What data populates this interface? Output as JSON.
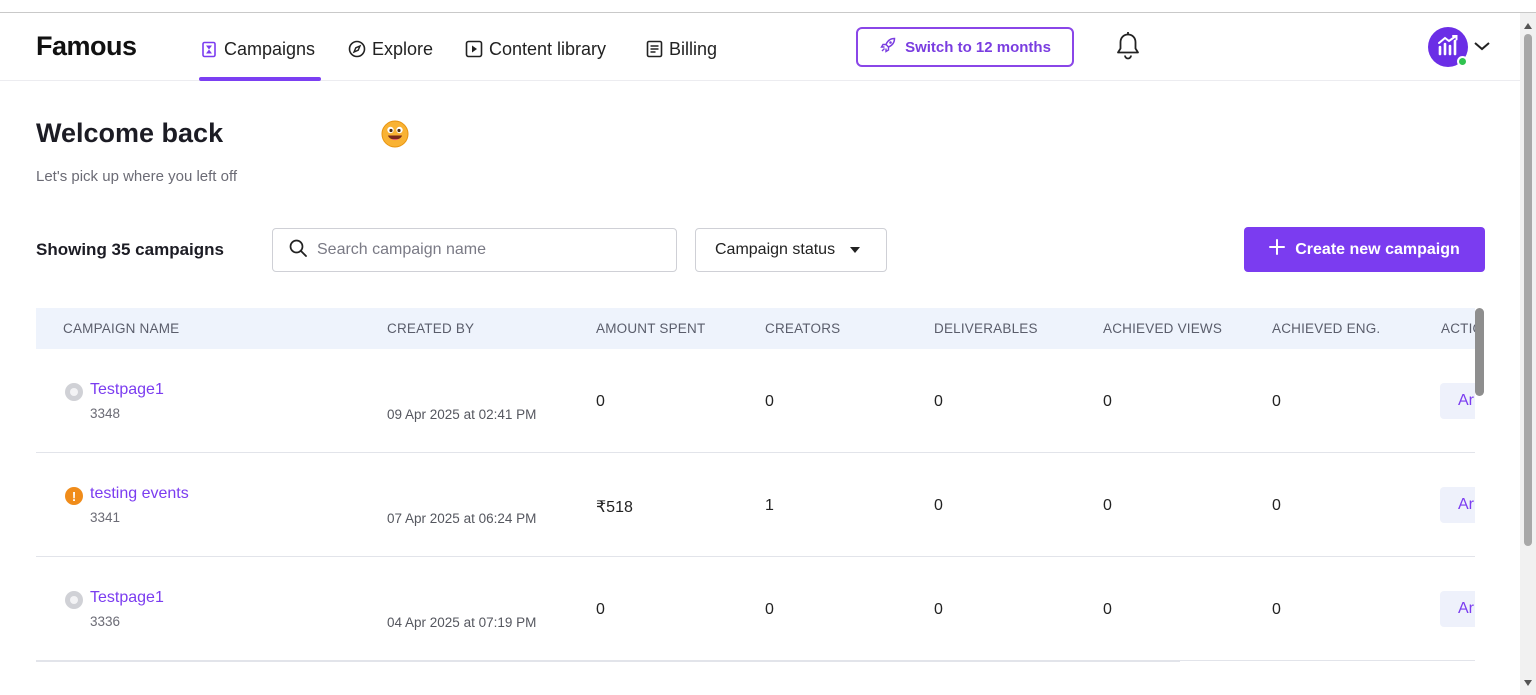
{
  "app": {
    "logo": "Famous"
  },
  "nav": {
    "items": [
      {
        "label": "Campaigns",
        "icon": "hourglass-icon",
        "active": true
      },
      {
        "label": "Explore",
        "icon": "compass-icon"
      },
      {
        "label": "Content library",
        "icon": "play-square-icon"
      },
      {
        "label": "Billing",
        "icon": "document-icon"
      }
    ]
  },
  "header": {
    "switch_label": "Switch to 12 months",
    "switch_icon": "rocket-icon",
    "bell_icon": "bell-icon",
    "avatar_icon": "chart-growth-icon",
    "online_color": "#2fc34f"
  },
  "welcome": {
    "title": "Welcome back",
    "emoji": "grinning-face",
    "subtitle": "Let's pick up where you left off"
  },
  "toolbar": {
    "showing": "Showing 35 campaigns",
    "search_placeholder": "Search campaign name",
    "status_filter": "Campaign status",
    "create_label": "Create new campaign"
  },
  "table": {
    "headers": [
      "CAMPAIGN NAME",
      "CREATED BY",
      "AMOUNT SPENT",
      "CREATORS",
      "DELIVERABLES",
      "ACHIEVED VIEWS",
      "ACHIEVED ENG.",
      "ACTIO"
    ],
    "rows": [
      {
        "status": "inactive",
        "name": "Testpage1",
        "id": "3348",
        "created_at": "09 Apr 2025 at 02:41 PM",
        "amount": "0",
        "creators": "0",
        "deliverables": "0",
        "views": "0",
        "engagement": "0",
        "action": "Ar"
      },
      {
        "status": "warning",
        "name": "testing events",
        "id": "3341",
        "created_at": "07 Apr 2025 at 06:24 PM",
        "amount": "₹518",
        "creators": "1",
        "deliverables": "0",
        "views": "0",
        "engagement": "0",
        "action": "Ar"
      },
      {
        "status": "inactive",
        "name": "Testpage1",
        "id": "3336",
        "created_at": "04 Apr 2025 at 07:19 PM",
        "amount": "0",
        "creators": "0",
        "deliverables": "0",
        "views": "0",
        "engagement": "0",
        "action": "Ar"
      }
    ]
  },
  "colors": {
    "brand": "#7b3cf0",
    "header_bg": "#eef3fc",
    "warning": "#f08c1a"
  }
}
